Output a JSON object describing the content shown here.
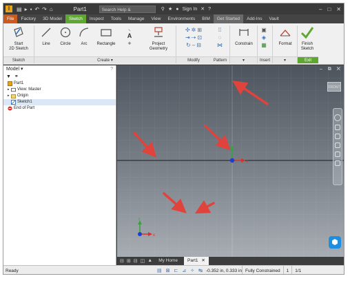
{
  "titlebar": {
    "app_letter": "I",
    "document_title": "Part1",
    "search_placeholder": "Search Help & Commands...",
    "sign_in": "Sign In",
    "vault": "Vault"
  },
  "tabs": [
    {
      "label": "File"
    },
    {
      "label": "Factory"
    },
    {
      "label": "3D Model"
    },
    {
      "label": "Sketch"
    },
    {
      "label": "Inspect"
    },
    {
      "label": "Tools"
    },
    {
      "label": "Manage"
    },
    {
      "label": "View"
    },
    {
      "label": "Environments"
    },
    {
      "label": "BIM"
    },
    {
      "label": "Get Started"
    },
    {
      "label": "Add-Ins"
    },
    {
      "label": "Vault"
    }
  ],
  "ribbon": {
    "tools": {
      "start_sketch_line1": "Start",
      "start_sketch_line2": "2D Sketch",
      "line": "Line",
      "circle": "Circle",
      "arc": "Arc",
      "rectangle": "Rectangle",
      "project_geometry_line1": "Project",
      "project_geometry_line2": "Geometry",
      "constrain": "Constrain",
      "format": "Format",
      "finish_sketch_line1": "Finish",
      "finish_sketch_line2": "Sketch"
    },
    "panels": {
      "sketch": "Sketch",
      "create": "Create ▾",
      "modify": "Modify",
      "pattern": "Pattern",
      "insert": "Insert",
      "exit": "Exit"
    }
  },
  "browser": {
    "title": "Model ▾",
    "help": "?",
    "items": [
      {
        "label": "Part1"
      },
      {
        "label": "View: Master"
      },
      {
        "label": "Origin"
      },
      {
        "label": "Sketch1"
      },
      {
        "label": "End of Part"
      }
    ]
  },
  "viewport": {
    "window_controls": "– ⧉ ✕",
    "viewcube_label": "FRONT",
    "axis_x": "x",
    "axis_y": "y"
  },
  "doctabs": {
    "home": "My Home",
    "part": "Part1"
  },
  "statusbar": {
    "ready": "Ready",
    "coords": "-0.352 in, 0.333 in",
    "constraint": "Fully Constrained",
    "count": "1",
    "pages": "1/1"
  },
  "colors": {
    "accent_green": "#5ea832",
    "file_tab": "#cc5a1e",
    "arrow_red": "#e0433b",
    "origin_blue": "#1a3fd1",
    "axis_red": "#d9302b",
    "axis_green": "#2fa83a"
  }
}
